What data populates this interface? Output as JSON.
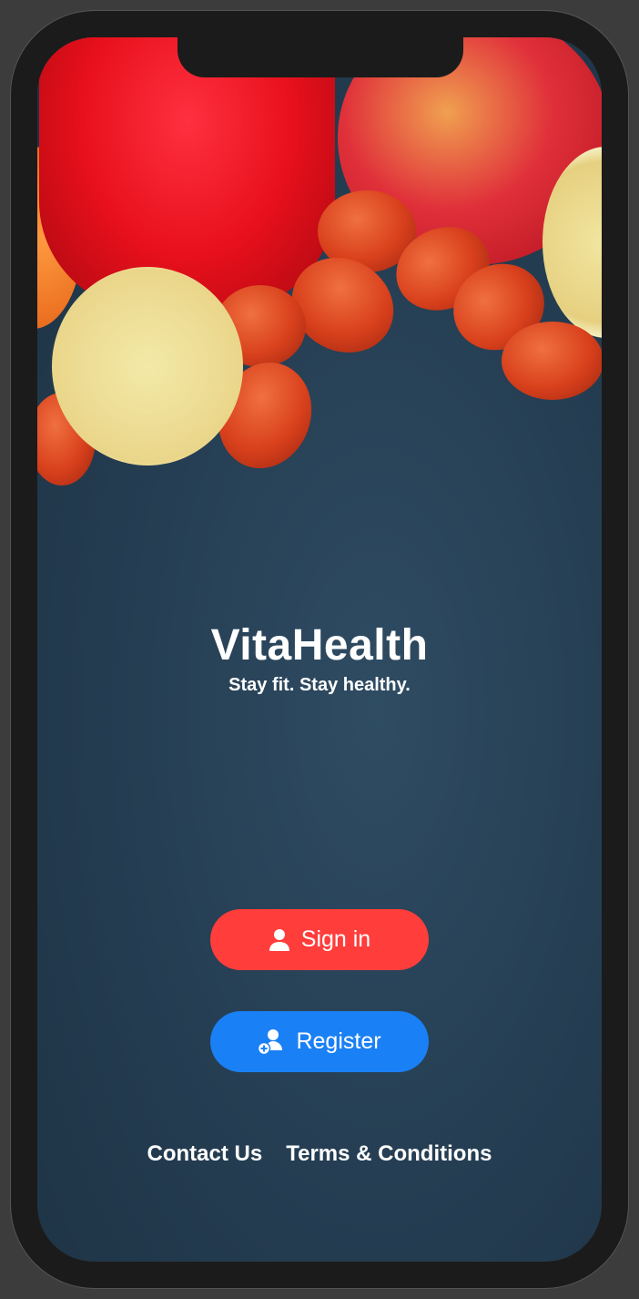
{
  "app": {
    "title": "VitaHealth",
    "tagline": "Stay fit. Stay healthy."
  },
  "buttons": {
    "sign_in": "Sign in",
    "register": "Register"
  },
  "links": {
    "contact": "Contact Us",
    "terms": "Terms & Conditions"
  },
  "colors": {
    "sign_in": "#ff3d3b",
    "register": "#1a80f5"
  }
}
